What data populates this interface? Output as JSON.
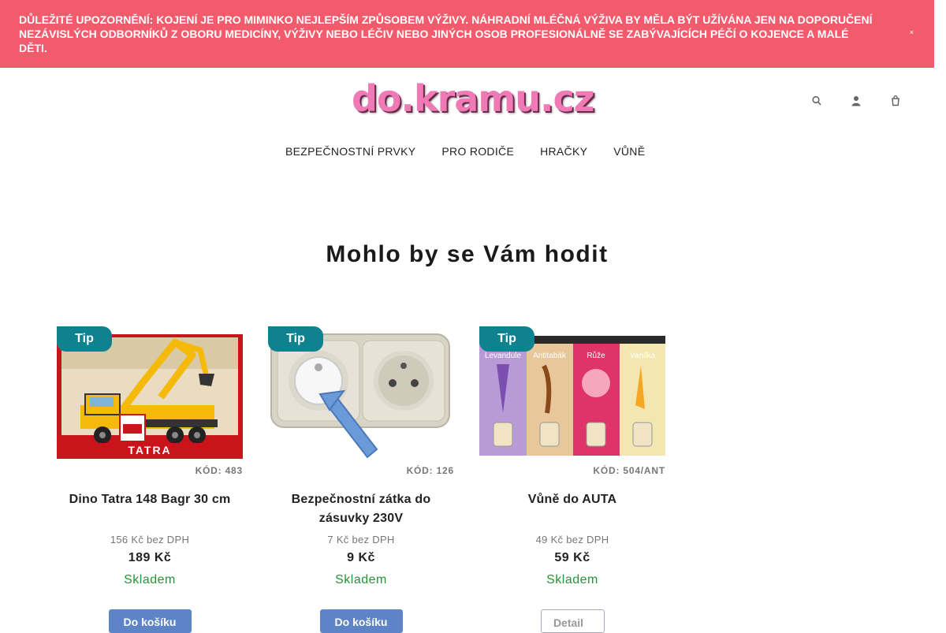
{
  "notice": {
    "text": "DŮLEŽITÉ UPOZORNĚNÍ: KOJENÍ JE PRO MIMINKO NEJLEPŠÍM ZPŮSOBEM VÝŽIVY. NÁHRADNÍ MLÉČNÁ VÝŽIVA BY MĚLA BÝT UŽÍVÁNA JEN NA DOPORUČENÍ NEZÁVISLÝCH ODBORNÍKŮ Z OBORU MEDICÍNY, VÝŽIVY NEBO LÉČIV NEBO JINÝCH OSOB PROFESIONÁLNĚ SE ZABÝVAJÍCÍCH PÉČÍ O KOJENCE A MALÉ DĚTI.",
    "close": "×"
  },
  "header": {
    "logo": "do.kramu.cz",
    "icons": [
      "search-icon",
      "user-icon",
      "cart-icon"
    ]
  },
  "nav": {
    "items": [
      "BEZPEČNOSTNÍ PRVKY",
      "PRO RODIČE",
      "HRAČKY",
      "VŮNĚ"
    ]
  },
  "section": {
    "title": "Mohlo by se Vám hodit"
  },
  "products": [
    {
      "badge": "Tip",
      "code": "KÓD: 483",
      "name": "Dino Tatra 148 Bagr 30 cm",
      "price_novat": "156 Kč bez DPH",
      "price": "189 Kč",
      "stock": "Skladem",
      "button": "Do košíku"
    },
    {
      "badge": "Tip",
      "code": "KÓD: 126",
      "name": "Bezpečnostní zátka do zásuvky 230V",
      "price_novat": "7 Kč bez DPH",
      "price": "9 Kč",
      "stock": "Skladem",
      "button": "Do košíku"
    },
    {
      "badge": "Tip",
      "code": "KÓD: 504/ANT",
      "name": "Vůně do AUTA",
      "price_novat": "49 Kč bez DPH",
      "price": "59 Kč",
      "stock": "Skladem",
      "button": "Detail"
    }
  ],
  "fragrance_labels": [
    "Levandule",
    "Antitabák",
    "Růže",
    "Vanilka"
  ],
  "truck_label": "TATRA",
  "colors": {
    "notice_bg": "#f15b6c",
    "badge_bg": "#0f8290",
    "stock_green": "#229636",
    "button_blue": "#5c84c6",
    "logo_pink": "#f07ab5"
  }
}
